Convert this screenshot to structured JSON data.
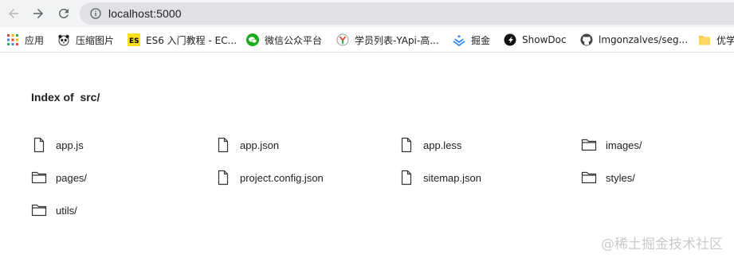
{
  "browser": {
    "url": "localhost:5000"
  },
  "bookmarks": [
    {
      "label": "应用",
      "icon": "apps-grid-icon"
    },
    {
      "label": "压缩图片",
      "icon": "panda-icon"
    },
    {
      "label": "ES6 入门教程 - EC...",
      "icon": "es-badge-icon"
    },
    {
      "label": "微信公众平台",
      "icon": "wechat-icon"
    },
    {
      "label": "学员列表-YApi-高...",
      "icon": "yapi-icon"
    },
    {
      "label": "掘金",
      "icon": "juejin-icon"
    },
    {
      "label": "ShowDoc",
      "icon": "showdoc-icon"
    },
    {
      "label": "lmgonzalves/seg...",
      "icon": "github-icon"
    },
    {
      "label": "优学",
      "icon": "folder-icon"
    }
  ],
  "page": {
    "title": "Index of  src/",
    "entries": [
      {
        "name": "app.js",
        "type": "file"
      },
      {
        "name": "app.json",
        "type": "file"
      },
      {
        "name": "app.less",
        "type": "file"
      },
      {
        "name": "images/",
        "type": "folder"
      },
      {
        "name": "pages/",
        "type": "folder"
      },
      {
        "name": "project.config.json",
        "type": "file"
      },
      {
        "name": "sitemap.json",
        "type": "file"
      },
      {
        "name": "styles/",
        "type": "folder"
      },
      {
        "name": "utils/",
        "type": "folder"
      }
    ]
  },
  "watermark": "@稀土掘金技术社区"
}
